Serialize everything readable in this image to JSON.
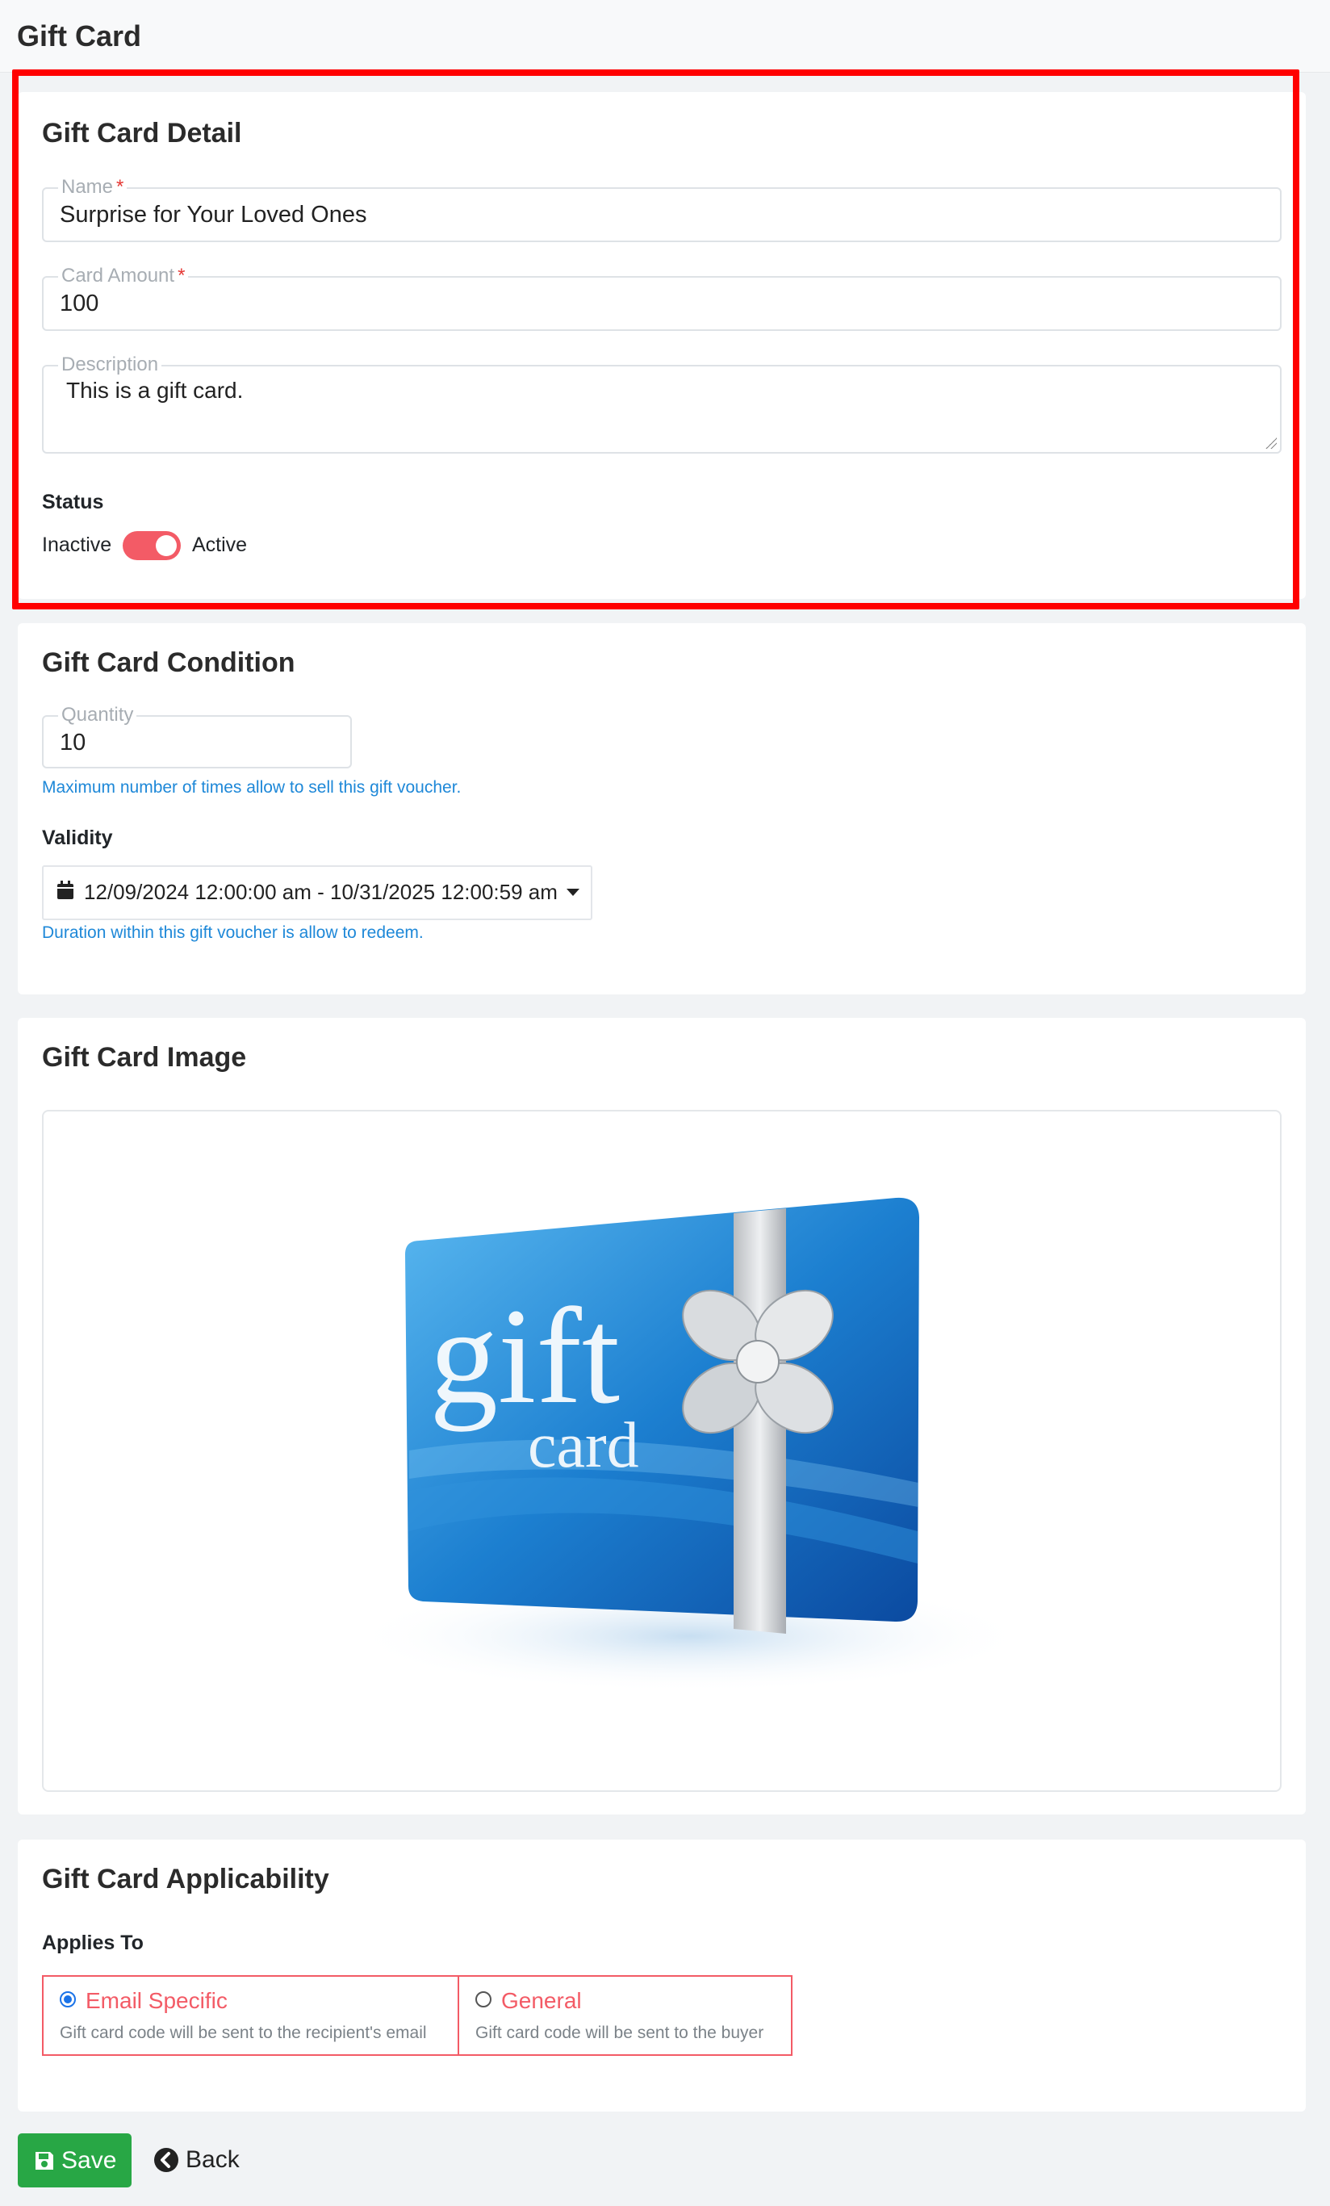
{
  "page": {
    "title": "Gift Card"
  },
  "detail": {
    "title": "Gift Card Detail",
    "name_label": "Name",
    "name_value": "Surprise for Your Loved Ones",
    "amount_label": "Card Amount",
    "amount_value": "100",
    "required_mark": "*",
    "description_label": "Description",
    "description_value": "This is a gift card.",
    "status_label": "Status",
    "status_off": "Inactive",
    "status_on": "Active",
    "status_active": true
  },
  "condition": {
    "title": "Gift Card Condition",
    "quantity_label": "Quantity",
    "quantity_value": "10",
    "quantity_help": "Maximum number of times allow to sell this gift voucher.",
    "validity_label": "Validity",
    "validity_range": "12/09/2024 12:00:00 am - 10/31/2025 12:00:59 am",
    "validity_help": "Duration within this gift voucher is allow to redeem."
  },
  "image": {
    "title": "Gift Card Image",
    "card_word_1": "gift",
    "card_word_2": "card"
  },
  "applicability": {
    "title": "Gift Card Applicability",
    "applies_to_label": "Applies To",
    "options": [
      {
        "title": "Email Specific",
        "subtitle": "Gift card code will be sent to the recipient's email",
        "checked": true
      },
      {
        "title": "General",
        "subtitle": "Gift card code will be sent to the buyer",
        "checked": false
      }
    ]
  },
  "actions": {
    "save": "Save",
    "back": "Back"
  },
  "colors": {
    "accent": "#f35b66",
    "save": "#28a745",
    "help": "#1e88d8",
    "highlight": "#ff0000"
  }
}
